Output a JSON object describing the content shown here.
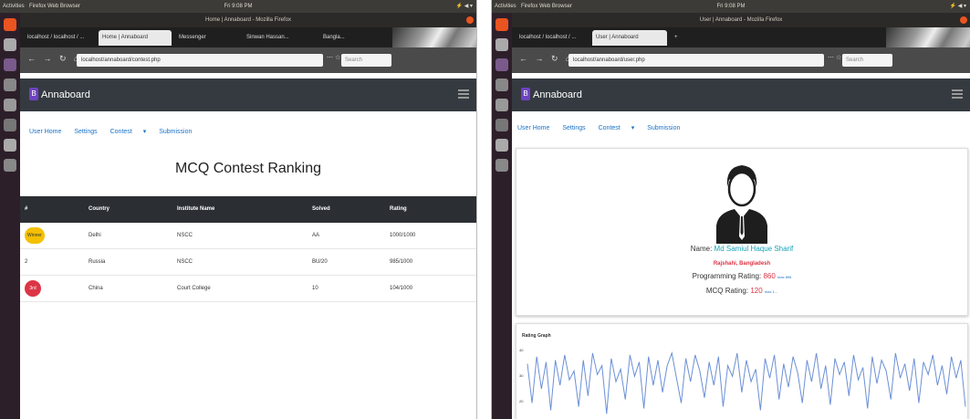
{
  "left": {
    "os_topbar": {
      "activities": "Activities",
      "app": "Firefox Web Browser",
      "clock": "Fri 9:08 PM"
    },
    "window_title": "Home | Annaboard - Mozilla Firefox",
    "tabs": [
      "localhost / localhost / ...",
      "Home | Annaboard",
      "Messenger",
      "Sinwan Hassan...",
      "Bangla..."
    ],
    "url": "localhost/annaboard/contest.php",
    "search_placeholder": "Search",
    "app_brand": "Annaboard",
    "menu": [
      "User Home",
      "Settings",
      "Contest",
      "Submission"
    ],
    "heading": "MCQ Contest Ranking",
    "table": {
      "headers": [
        "#",
        "Country",
        "Institute Name",
        "Solved",
        "Rating"
      ],
      "rows": [
        {
          "rank": "Winner",
          "country": "Delhi",
          "institute": "NSCC",
          "solved": "AA",
          "rating": "1000/1000"
        },
        {
          "rank": "2",
          "country": "Russia",
          "institute": "NSCC",
          "solved": "BU/20",
          "rating": "985/1000"
        },
        {
          "rank": "3rd",
          "country": "China",
          "institute": "Court College",
          "solved": "10",
          "rating": "104/1000"
        }
      ]
    }
  },
  "right": {
    "os_topbar": {
      "activities": "Activities",
      "app": "Firefox Web Browser",
      "clock": "Fri 9:08 PM"
    },
    "window_title": "User | Annaboard - Mozilla Firefox",
    "tabs": [
      "localhost / localhost / ...",
      "User | Annaboard"
    ],
    "url": "localhost/annaboard/user.php",
    "search_placeholder": "Search",
    "app_brand": "Annaboard",
    "menu": [
      "User Home",
      "Settings",
      "Contest",
      "Submission"
    ],
    "profile": {
      "name_label": "Name:",
      "name": "Md Samiul Haque Sharif",
      "location": "Rajshahi, Bangladesh",
      "programming_rating_label": "Programming Rating:",
      "programming_rating": "860",
      "programming_rating_note": "max 896",
      "mcq_rating_label": "MCQ Rating:",
      "mcq_rating": "120",
      "mcq_rating_note": "max 1..."
    },
    "graph_title": "Rating Graph",
    "graph_y_ticks": [
      "40",
      "30",
      "20"
    ],
    "graph_values": [
      34,
      12,
      38,
      20,
      35,
      8,
      36,
      22,
      39,
      25,
      30,
      10,
      36,
      16,
      40,
      28,
      33,
      6,
      37,
      24,
      31,
      14,
      39,
      27,
      35,
      9,
      38,
      22,
      36,
      18,
      33,
      40,
      26,
      12,
      37,
      24,
      39,
      30,
      15,
      35,
      22,
      38,
      10,
      33,
      27,
      40,
      18,
      36,
      24,
      31,
      8,
      37,
      26,
      39,
      14,
      34,
      21,
      38,
      29,
      12,
      36,
      24,
      40,
      20,
      33,
      11,
      37,
      28,
      35,
      16,
      39,
      25,
      32,
      9,
      38,
      23,
      36,
      30,
      14,
      40,
      26,
      34,
      19,
      37,
      12,
      35,
      28,
      39,
      22,
      33,
      17,
      38,
      26,
      36,
      10
    ]
  },
  "colors": {
    "appbar": "#343a40",
    "link": "#1a73c8",
    "table_header": "#2b2e33",
    "gold_badge": "#f5c000",
    "red_badge": "#dc3545",
    "graph_line": "#6b8fd6",
    "launcher": "#2d1f2a",
    "os_topbar": "#3c3b37"
  }
}
